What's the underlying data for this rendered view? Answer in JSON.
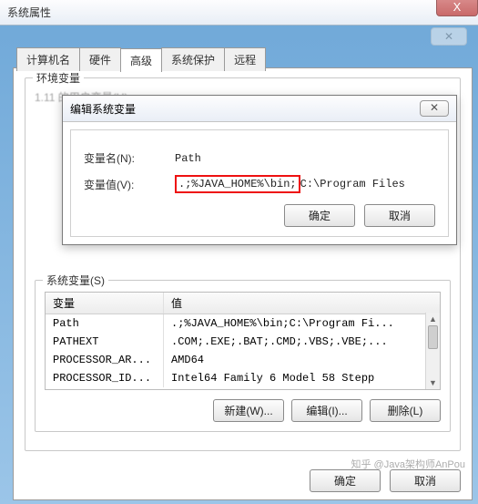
{
  "window": {
    "title": "系统属性",
    "close_glyph": "X"
  },
  "tabs": {
    "computer_name": "计算机名",
    "hardware": "硬件",
    "advanced": "高级",
    "system_protection": "系统保护",
    "remote": "远程"
  },
  "env_group": {
    "legend": "环境变量",
    "user_vars_stub": "1.11 的用户变量(U)"
  },
  "edit_dialog": {
    "title": "编辑系统变量",
    "close_glyph": "✕",
    "name_label": "变量名(N):",
    "name_value": "Path",
    "value_label": "变量值(V):",
    "value_hl": ".;%JAVA_HOME%\\bin;",
    "value_rest": "C:\\Program Files",
    "ok": "确定",
    "cancel": "取消"
  },
  "sys_group": {
    "legend": "系统变量(S)",
    "col_var": "变量",
    "col_val": "值",
    "rows": [
      {
        "name": "Path",
        "value": ".;%JAVA_HOME%\\bin;C:\\Program Fi..."
      },
      {
        "name": "PATHEXT",
        "value": ".COM;.EXE;.BAT;.CMD;.VBS;.VBE;..."
      },
      {
        "name": "PROCESSOR_AR...",
        "value": "AMD64"
      },
      {
        "name": "PROCESSOR_ID...",
        "value": "Intel64 Family 6 Model 58 Stepp"
      }
    ],
    "new_btn": "新建(W)...",
    "edit_btn": "编辑(I)...",
    "del_btn": "删除(L)"
  },
  "footer": {
    "ok": "确定",
    "cancel": "取消"
  },
  "watermark": "知乎 @Java架构师AnPou"
}
